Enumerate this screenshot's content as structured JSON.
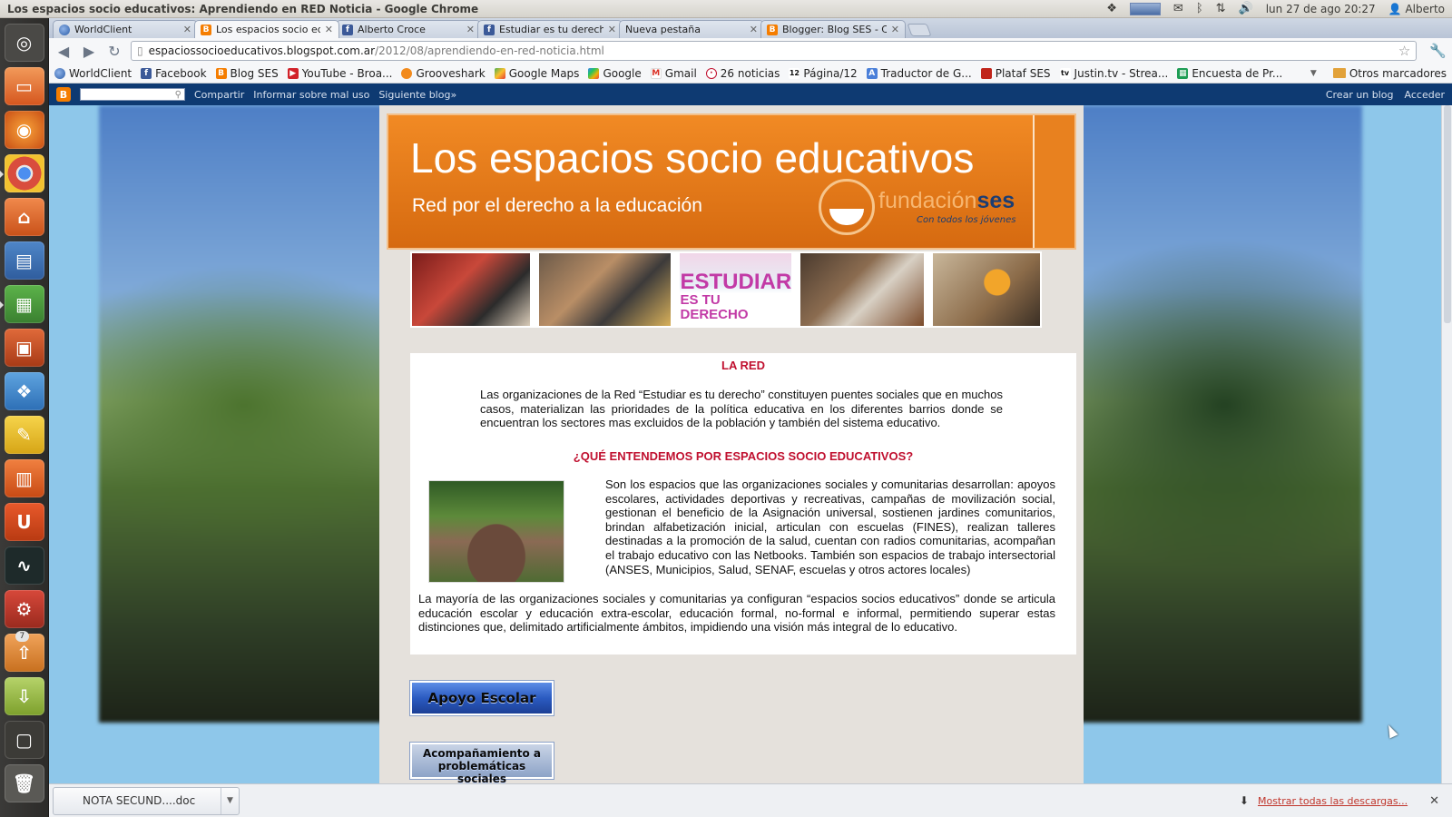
{
  "window": {
    "title": "Los espacios socio educativos: Aprendiendo en RED Noticia - Google Chrome"
  },
  "top_panel": {
    "clock": "lun 27 de ago 20:27",
    "user": "Alberto"
  },
  "launcher": {
    "badge_count": "7"
  },
  "tabs": [
    {
      "label": "WorldClient",
      "icon": "globe-icon"
    },
    {
      "label": "Los espacios socio educati",
      "icon": "blogger-icon"
    },
    {
      "label": "Alberto Croce",
      "icon": "facebook-icon"
    },
    {
      "label": "Estudiar es tu derecho",
      "icon": "facebook-icon"
    },
    {
      "label": "Nueva pestaña",
      "icon": ""
    },
    {
      "label": "Blogger: Blog SES - Crear",
      "icon": "blogger-icon"
    }
  ],
  "omnibox": {
    "host": "espaciossocioeducativos.blogspot.com.ar",
    "path": "/2012/08/aprendiendo-en-red-noticia.html"
  },
  "bookmarks": [
    {
      "label": "WorldClient",
      "icon": "globe-icon"
    },
    {
      "label": "Facebook",
      "icon": "facebook-icon"
    },
    {
      "label": "Blog SES",
      "icon": "blogger-icon"
    },
    {
      "label": "YouTube - Broa...",
      "icon": "youtube-icon"
    },
    {
      "label": "Grooveshark",
      "icon": "grooveshark-icon"
    },
    {
      "label": "Google Maps",
      "icon": "maps-icon"
    },
    {
      "label": "Google",
      "icon": "google-icon"
    },
    {
      "label": "Gmail",
      "icon": "gmail-icon"
    },
    {
      "label": "26 noticias",
      "icon": "news-icon"
    },
    {
      "label": "Página/12",
      "icon": "p12-icon"
    },
    {
      "label": "Traductor de G...",
      "icon": "translate-icon"
    },
    {
      "label": "Plataf SES",
      "icon": "plataf-icon"
    },
    {
      "label": "Justin.tv - Strea...",
      "icon": "justin-icon"
    },
    {
      "label": "Encuesta de Pr...",
      "icon": "sheets-icon"
    }
  ],
  "bookmarks_other": "Otros marcadores",
  "blogger_navbar": {
    "share": "Compartir",
    "report": "Informar sobre mal uso",
    "next": "Siguiente blog»",
    "create": "Crear un blog",
    "signin": "Acceder"
  },
  "blog": {
    "title": "Los espacios socio educativos",
    "description": "Red por el derecho a la educación",
    "logo_main": "fundación",
    "logo_bold": "ses",
    "logo_sub": "Con todos los jóvenes",
    "strip_text_big": "ESTUDIAR",
    "strip_text_small": "ES TU DERECHO"
  },
  "post": {
    "heading1": "LA RED",
    "para1": "Las organizaciones de la Red “Estudiar es tu derecho” constituyen puentes sociales que en muchos casos, materializan las prioridades de la política educativa en los diferentes barrios donde se encuentran los sectores mas excluidos de la población y también del sistema educativo.",
    "heading2": "¿QUÉ ENTENDEMOS POR ESPACIOS SOCIO EDUCATIVOS?",
    "para2": "Son los espacios que las organizaciones sociales y comunitarias desarrollan: apoyos escolares, actividades deportivas y recreativas, campañas de movilización social, gestionan el beneficio de la Asignación universal, sostienen jardines comunitarios, brindan alfabetización inicial, articulan con escuelas (FINES), realizan talleres destinadas a la promoción de la salud, cuentan con radios comunitarias, acompañan el trabajo educativo con las Netbooks. También son espacios de trabajo intersectorial (ANSES, Municipios, Salud, SENAF, escuelas y otros actores locales)",
    "para3": "La mayoría de las organizaciones sociales y comunitarias ya configuran “espacios socios educativos” donde se articula educación escolar y educación extra-escolar, educación formal, no-formal e informal, permitiendo superar estas distinciones que, delimitado artificialmente ámbitos, impidiendo una visión más integral de lo educativo."
  },
  "buttons": {
    "apoyo": "Apoyo Escolar",
    "acomp": "Acompañamiento a problemáticas sociales"
  },
  "downloads": {
    "file": "NOTA SECUND....doc",
    "show_all": "Mostrar todas las descargas..."
  },
  "colors": {
    "blogger_orange": "#f57d00",
    "header_orange": "#e8811f",
    "heading_red": "#c0102f",
    "navbar_blue": "#0e3a72"
  }
}
